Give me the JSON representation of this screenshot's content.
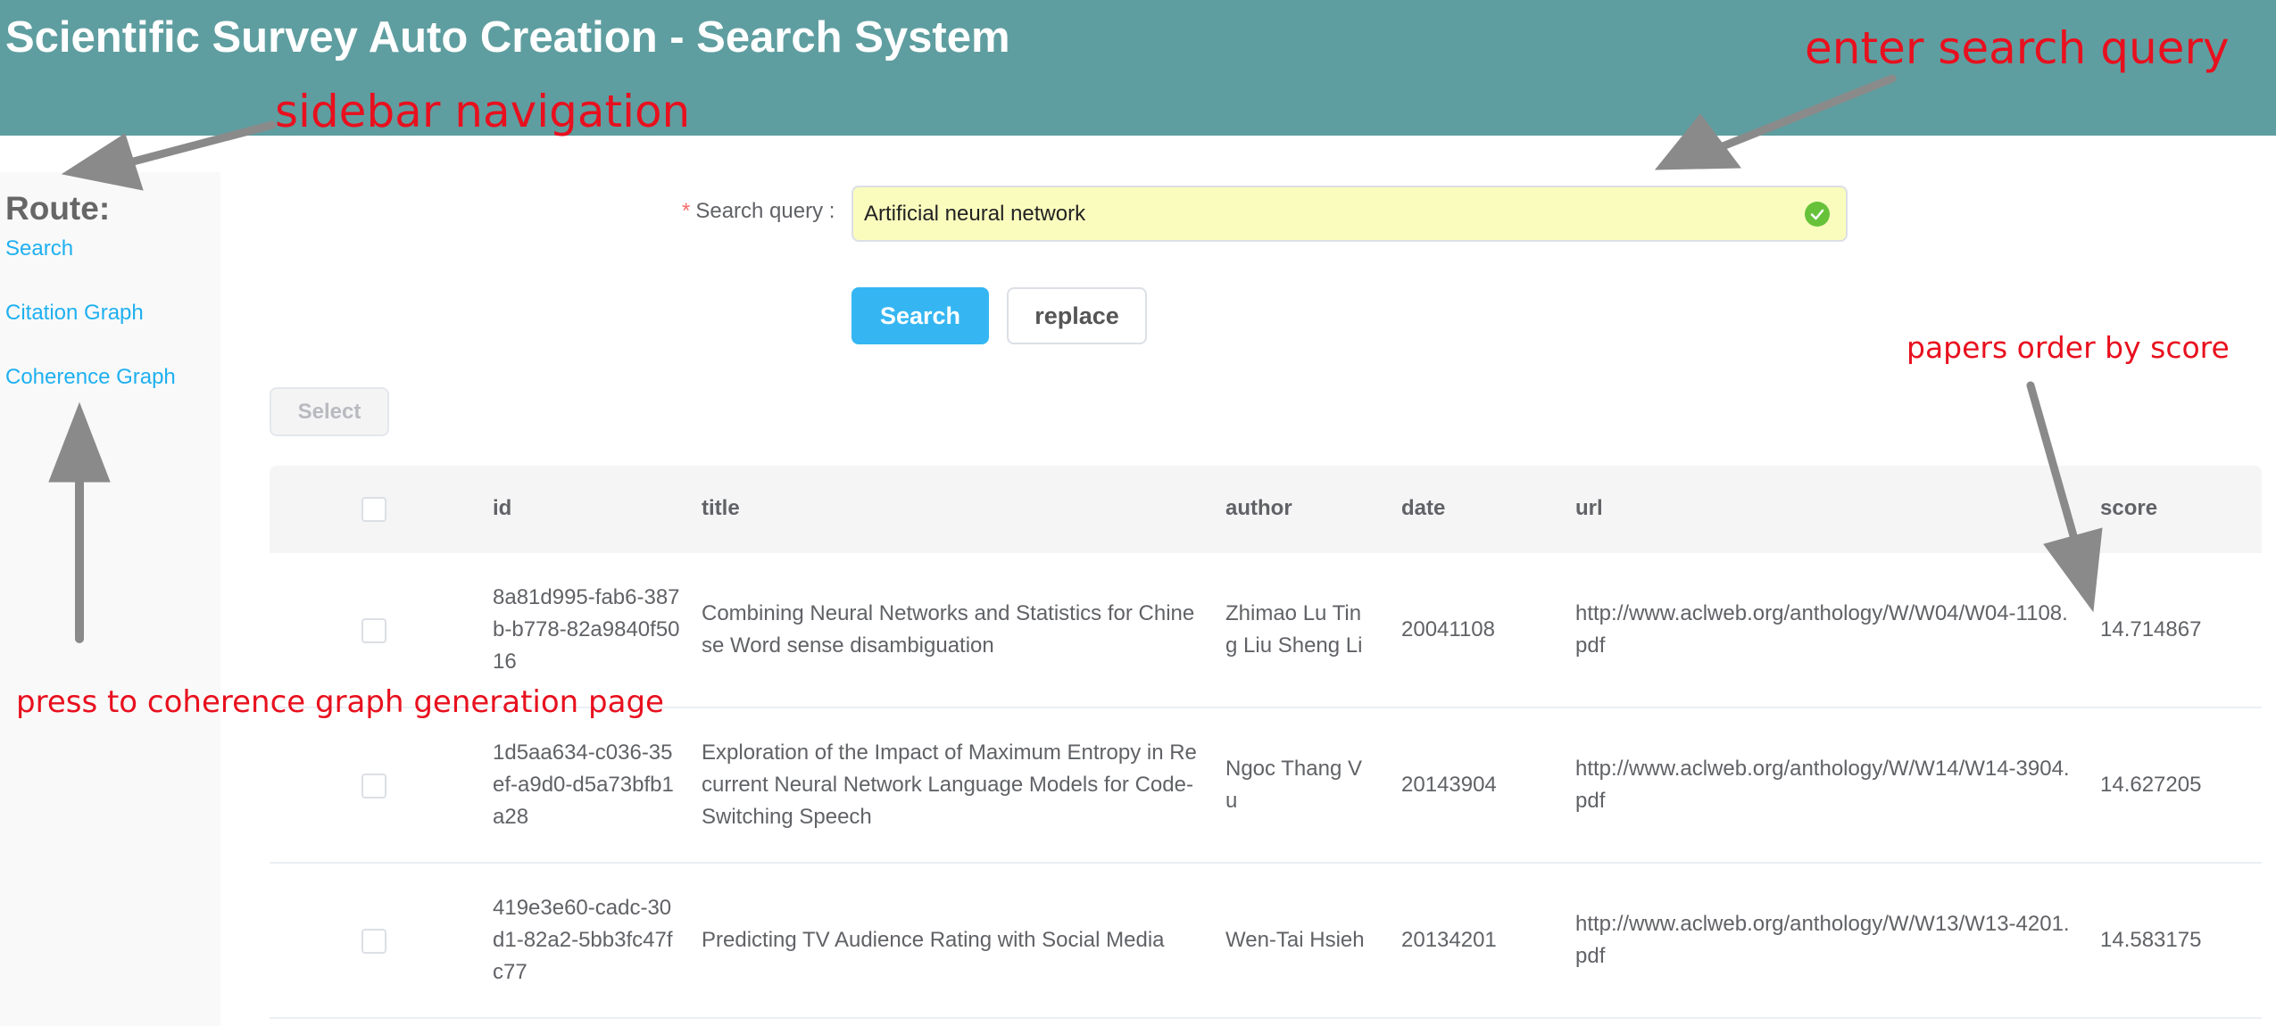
{
  "header": {
    "title": "Scientific Survey Auto Creation - Search System"
  },
  "sidebar": {
    "route_label": "Route:",
    "items": [
      {
        "label": "Search"
      },
      {
        "label": "Citation Graph"
      },
      {
        "label": "Coherence Graph"
      }
    ]
  },
  "search": {
    "required_mark": "*",
    "label": "Search query :",
    "value": "Artificial neural network",
    "search_button": "Search",
    "replace_button": "replace"
  },
  "select_button": "Select",
  "table": {
    "columns": [
      "id",
      "title",
      "author",
      "date",
      "url",
      "score"
    ],
    "rows": [
      {
        "id": "8a81d995-fab6-387b-b778-82a9840f5016",
        "title": "Combining Neural Networks and Statistics for Chinese Word sense disambiguation",
        "author": "Zhimao Lu Ting Liu Sheng Li",
        "date": "20041108",
        "url": "http://www.aclweb.org/anthology/W/W04/W04-1108.pdf",
        "score": "14.714867"
      },
      {
        "id": "1d5aa634-c036-35ef-a9d0-d5a73bfb1a28",
        "title": "Exploration of the Impact of Maximum Entropy in Recurrent Neural Network Language Models for Code-Switching Speech",
        "author": "Ngoc Thang Vu",
        "date": "20143904",
        "url": "http://www.aclweb.org/anthology/W/W14/W14-3904.pdf",
        "score": "14.627205"
      },
      {
        "id": "419e3e60-cadc-30d1-82a2-5bb3fc47fc77",
        "title": "Predicting TV Audience Rating with Social Media",
        "author": "Wen-Tai Hsieh",
        "date": "20134201",
        "url": "http://www.aclweb.org/anthology/W/W13/W13-4201.pdf",
        "score": "14.583175"
      }
    ]
  },
  "annotations": {
    "sidebar_navigation": "sidebar navigation",
    "enter_search_query": "enter search query",
    "papers_order": "papers order by score",
    "coherence_page": "press to coherence graph generation page"
  },
  "colors": {
    "header": "#5f9ea0",
    "link": "#1eb0f0",
    "primary_button": "#35b6f2",
    "input_highlight": "#fafcbe",
    "success": "#67c23a",
    "annotation": "#e8101e",
    "arrow": "#8a8a8a"
  },
  "icons": {
    "input_status": "check-circle-icon",
    "annotation_arrow": "arrow-icon"
  }
}
